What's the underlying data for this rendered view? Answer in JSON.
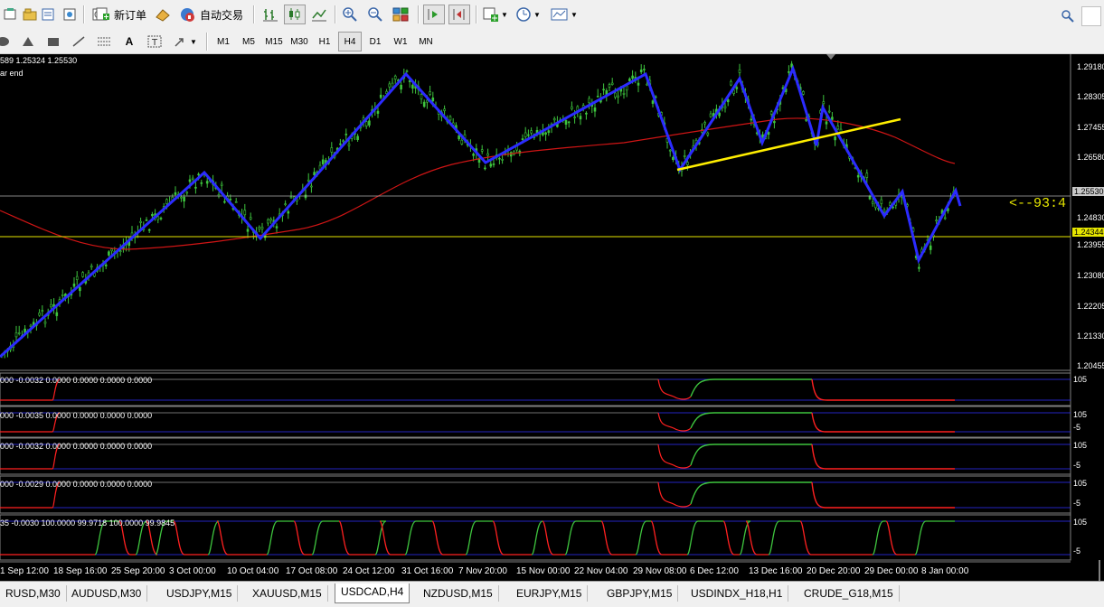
{
  "toolbar": {
    "new_order_label": "新订单",
    "auto_trade_label": "自动交易",
    "timeframes": [
      "M1",
      "M5",
      "M15",
      "M30",
      "H1",
      "H4",
      "D1",
      "W1",
      "MN"
    ],
    "active_timeframe": "H4",
    "line_style_label": "A"
  },
  "chart": {
    "header_line1": "589 1.25324 1.25530",
    "header_line2": "ar end",
    "annotation": "<--93:4",
    "price_labels": [
      "1.29180",
      "1.28305",
      "1.27455",
      "1.26580",
      "1.25530",
      "1.24830",
      "1.24344",
      "1.23955",
      "1.23080",
      "1.22205",
      "1.21330",
      "1.20455"
    ],
    "current_price": "1.25530",
    "hline_price": "1.24344",
    "time_labels": [
      "1 Sep 12:00",
      "18 Sep 16:00",
      "25 Sep 20:00",
      "3 Oct 00:00",
      "10 Oct 04:00",
      "17 Oct 08:00",
      "24 Oct 12:00",
      "31 Oct 16:00",
      "7 Nov 20:00",
      "15 Nov 00:00",
      "22 Nov 04:00",
      "29 Nov 08:00",
      "6 Dec 12:00",
      "13 Dec 16:00",
      "20 Dec 20:00",
      "29 Dec 00:00",
      "8 Jan 00:00"
    ],
    "colors": {
      "zigzag": "#2b2bff",
      "trendline": "#ffee00",
      "ma": "#d01515",
      "bull": "#3ec43e",
      "hline": "#e6e600",
      "current": "#b0b0b0"
    }
  },
  "indicators": [
    {
      "text": "000 -0.0032 0.0000 0.0000 0.0000 0.0000",
      "label_top": "105",
      "label_bot": ""
    },
    {
      "text": "000 -0.0035 0.0000 0.0000 0.0000 0.0000",
      "label_top": "105",
      "label_bot": "-5"
    },
    {
      "text": "000 -0.0032 0.0000 0.0000 0.0000 0.0000",
      "label_top": "105",
      "label_bot": "-5"
    },
    {
      "text": "000 -0.0029 0.0000 0.0000 0.0000 0.0000",
      "label_top": "105",
      "label_bot": "-5"
    },
    {
      "text": "35 -0.0030 100.0000 99.9718 100.0000 99.9845",
      "label_top": "105",
      "label_bot": "-5"
    }
  ],
  "tabs": [
    "RUSD,M30",
    "AUDUSD,M30",
    "USDJPY,M15",
    "XAUUSD,M15",
    "USDCAD,H4",
    "NZDUSD,M15",
    "EURJPY,M15",
    "GBPJPY,M15",
    "USDINDX_H18,H1",
    "CRUDE_G18,M15"
  ],
  "active_tab": "USDCAD,H4"
}
